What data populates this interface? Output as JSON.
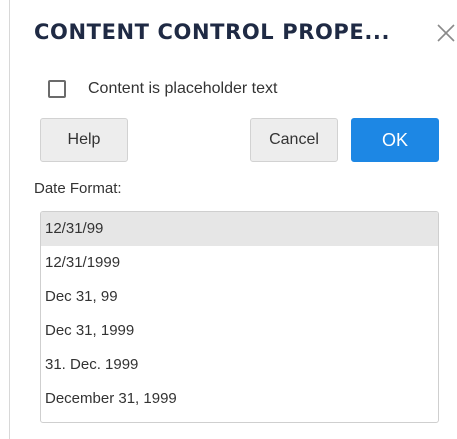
{
  "dialog": {
    "title": "CONTENT CONTROL PROPE...",
    "close_icon": "close-icon"
  },
  "placeholder": {
    "label": "Content is placeholder text",
    "checked": false
  },
  "buttons": {
    "help_label": "Help",
    "cancel_label": "Cancel",
    "ok_label": "OK"
  },
  "date_format": {
    "label": "Date Format:",
    "options": [
      "12/31/99",
      "12/31/1999",
      "Dec 31, 99",
      "Dec 31, 1999",
      "31. Dec. 1999",
      "December 31, 1999"
    ],
    "selected": "12/31/99"
  },
  "colors": {
    "accent": "#1d87e4",
    "title": "#1f2a44",
    "selected_row": "#e6e6e6"
  }
}
